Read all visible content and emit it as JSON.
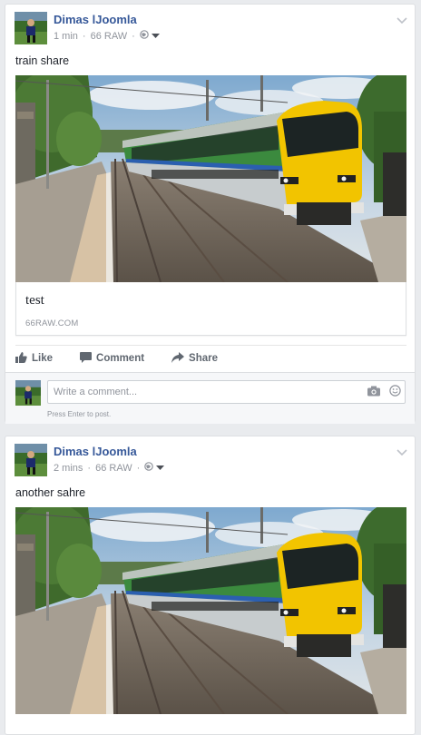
{
  "posts": [
    {
      "author": "Dimas lJoomla",
      "time": "1 min",
      "page": "66 RAW",
      "text": "train share",
      "link_title": "test",
      "link_domain": "66RAW.COM",
      "actions": {
        "like": "Like",
        "comment": "Comment",
        "share": "Share"
      },
      "comment_placeholder": "Write a comment...",
      "comment_hint": "Press Enter to post."
    },
    {
      "author": "Dimas lJoomla",
      "time": "2 mins",
      "page": "66 RAW",
      "text": "another sahre"
    }
  ],
  "colors": {
    "author": "#365899",
    "muted": "#90949c",
    "action": "#606770",
    "train_yellow": "#f2c400",
    "train_green": "#2e8a3a"
  },
  "icons": [
    "globe-icon",
    "caret-down-icon",
    "chevron-down-icon",
    "like-icon",
    "comment-icon",
    "share-icon",
    "camera-icon",
    "emoji-icon"
  ]
}
